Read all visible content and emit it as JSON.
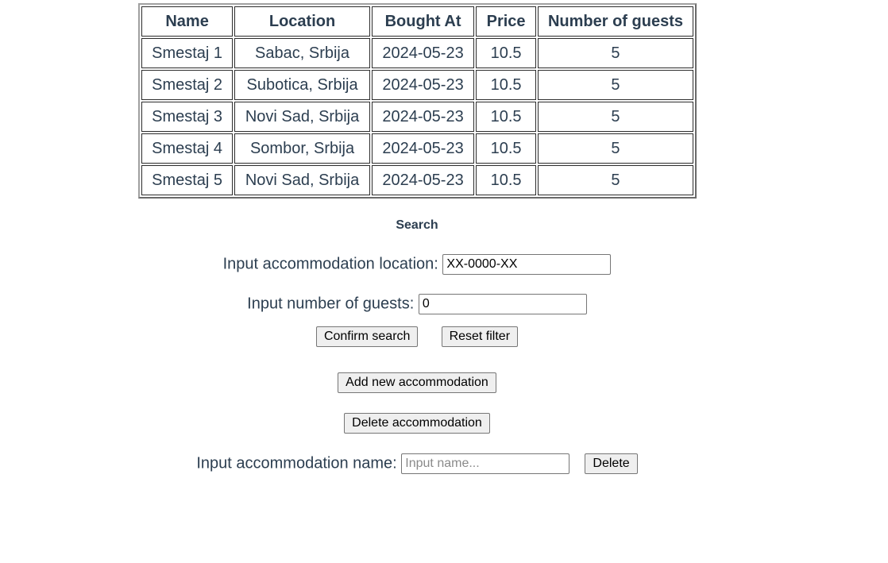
{
  "table": {
    "headers": [
      "Name",
      "Location",
      "Bought At",
      "Price",
      "Number of guests"
    ],
    "rows": [
      {
        "name": "Smestaj 1",
        "location": "Sabac, Srbija",
        "bought_at": "2024-05-23",
        "price": "10.5",
        "guests": "5"
      },
      {
        "name": "Smestaj 2",
        "location": "Subotica, Srbija",
        "bought_at": "2024-05-23",
        "price": "10.5",
        "guests": "5"
      },
      {
        "name": "Smestaj 3",
        "location": "Novi Sad, Srbija",
        "bought_at": "2024-05-23",
        "price": "10.5",
        "guests": "5"
      },
      {
        "name": "Smestaj 4",
        "location": "Sombor, Srbija",
        "bought_at": "2024-05-23",
        "price": "10.5",
        "guests": "5"
      },
      {
        "name": "Smestaj 5",
        "location": "Novi Sad, Srbija",
        "bought_at": "2024-05-23",
        "price": "10.5",
        "guests": "5"
      }
    ]
  },
  "search": {
    "title": "Search",
    "location_label": "Input accommodation location:",
    "location_value": "XX-0000-XX",
    "guests_label": "Input number of guests:",
    "guests_value": "0",
    "confirm_label": "Confirm search",
    "reset_label": "Reset filter"
  },
  "actions": {
    "add_label": "Add new accommodation",
    "delete_label": "Delete accommodation"
  },
  "delete_form": {
    "name_label": "Input accommodation name:",
    "name_placeholder": "Input name...",
    "delete_button_label": "Delete"
  }
}
